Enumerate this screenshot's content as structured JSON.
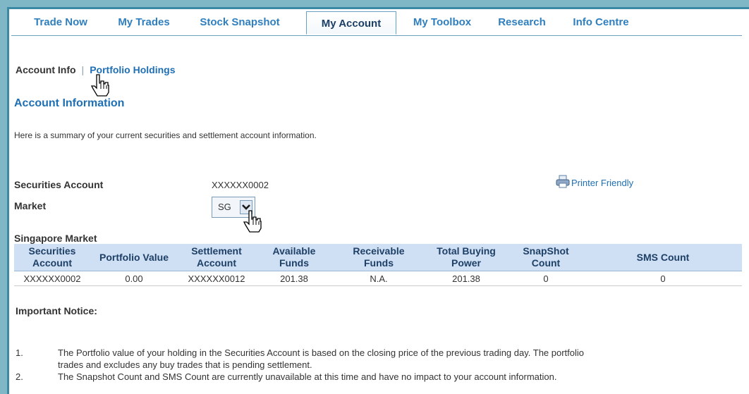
{
  "tabs": [
    {
      "label": "Trade Now",
      "active": false
    },
    {
      "label": "My Trades",
      "active": false
    },
    {
      "label": "Stock Snapshot",
      "active": false
    },
    {
      "label": "My Account",
      "active": true
    },
    {
      "label": "My Toolbox",
      "active": false
    },
    {
      "label": "Research",
      "active": false
    },
    {
      "label": "Info Centre",
      "active": false
    }
  ],
  "subnav": {
    "current": "Account Info",
    "separator": "|",
    "link": "Portfolio Holdings"
  },
  "page_title": "Account Information",
  "summary": "Here is a summary of your current securities and settlement account information.",
  "account": {
    "securities_label": "Securities Account",
    "securities_value": "XXXXXX0002",
    "market_label": "Market",
    "market_value": "SG",
    "printer_label": "Printer Friendly"
  },
  "market_section": "Singapore Market",
  "table": {
    "headers": [
      [
        "Securities",
        "Account"
      ],
      [
        "Portfolio Value"
      ],
      [
        "Settlement",
        "Account"
      ],
      [
        "Available",
        "Funds"
      ],
      [
        "Receivable",
        "Funds"
      ],
      [
        "Total Buying",
        "Power"
      ],
      [
        "SnapShot",
        "Count"
      ],
      [
        "SMS Count"
      ]
    ],
    "row": [
      "XXXXXX0002",
      "0.00",
      "XXXXXX0012",
      "201.38",
      "N.A.",
      "201.38",
      "0",
      "0"
    ]
  },
  "notice_title": "Important Notice:",
  "notes": [
    {
      "num": "1.",
      "lines": [
        "The Portfolio value of your holding in the Securities Account is based on the closing price of the previous trading day. The portfolio",
        "trades and excludes any buy trades that is pending settlement."
      ]
    },
    {
      "num": "2.",
      "lines": [
        "The Snapshot Count and SMS Count are currently unavailable at this time and have no impact to your account information."
      ]
    }
  ],
  "colors": {
    "accent": "#1e6fb4",
    "header_bg": "#cfe0f4",
    "frame": "#3a8aa6"
  },
  "icons": [
    "printer-icon",
    "hand-cursor-icon",
    "chevron-down-icon"
  ]
}
